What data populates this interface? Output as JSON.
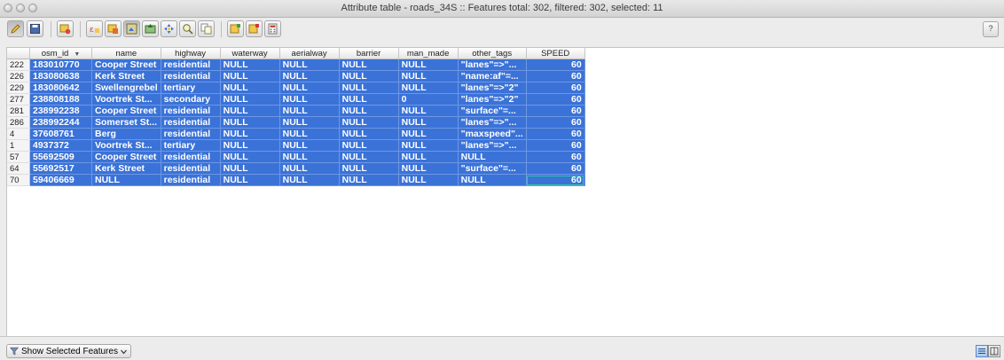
{
  "window": {
    "title": "Attribute table - roads_34S :: Features total: 302, filtered: 302, selected: 11"
  },
  "toolbar": {
    "buttons": [
      "toggle-editing",
      "save-edits",
      "delete-selected",
      "expression-select",
      "select-all",
      "invert-selection",
      "move-selection-to-top",
      "pan-to-selected",
      "zoom-to-selected",
      "copy-selected",
      "add-attribute",
      "delete-attribute",
      "open-field-calculator",
      "conditional-formatting"
    ],
    "help_label": "?"
  },
  "table": {
    "columns": [
      "osm_id",
      "name",
      "highway",
      "waterway",
      "aerialway",
      "barrier",
      "man_made",
      "other_tags",
      "SPEED"
    ],
    "sorted_column": "osm_id",
    "sort_indicator": "▼",
    "rows": [
      {
        "n": "222",
        "cells": [
          "183010770",
          "Cooper Street",
          "residential",
          "NULL",
          "NULL",
          "NULL",
          "NULL",
          "\"lanes\"=>\"...",
          "60"
        ]
      },
      {
        "n": "226",
        "cells": [
          "183080638",
          "Kerk Street",
          "residential",
          "NULL",
          "NULL",
          "NULL",
          "NULL",
          "\"name:af\"=...",
          "60"
        ]
      },
      {
        "n": "229",
        "cells": [
          "183080642",
          "Swellengrebel",
          "tertiary",
          "NULL",
          "NULL",
          "NULL",
          "NULL",
          "\"lanes\"=>\"2\"",
          "60"
        ]
      },
      {
        "n": "277",
        "cells": [
          "238808188",
          "Voortrek St...",
          "secondary",
          "NULL",
          "NULL",
          "NULL",
          "0",
          "\"lanes\"=>\"2\"",
          "60"
        ]
      },
      {
        "n": "281",
        "cells": [
          "238992238",
          "Cooper Street",
          "residential",
          "NULL",
          "NULL",
          "NULL",
          "NULL",
          "\"surface\"=...",
          "60"
        ]
      },
      {
        "n": "286",
        "cells": [
          "238992244",
          "Somerset St...",
          "residential",
          "NULL",
          "NULL",
          "NULL",
          "NULL",
          "\"lanes\"=>\"...",
          "60"
        ]
      },
      {
        "n": "4",
        "cells": [
          "37608761",
          "Berg",
          "residential",
          "NULL",
          "NULL",
          "NULL",
          "NULL",
          "\"maxspeed\"...",
          "60"
        ]
      },
      {
        "n": "1",
        "cells": [
          "4937372",
          "Voortrek St...",
          "tertiary",
          "NULL",
          "NULL",
          "NULL",
          "NULL",
          "\"lanes\"=>\"...",
          "60"
        ]
      },
      {
        "n": "57",
        "cells": [
          "55692509",
          "Cooper Street",
          "residential",
          "NULL",
          "NULL",
          "NULL",
          "NULL",
          "NULL",
          "60"
        ]
      },
      {
        "n": "64",
        "cells": [
          "55692517",
          "Kerk Street",
          "residential",
          "NULL",
          "NULL",
          "NULL",
          "NULL",
          "\"surface\"=...",
          "60"
        ]
      },
      {
        "n": "70",
        "cells": [
          "59406669",
          "NULL",
          "residential",
          "NULL",
          "NULL",
          "NULL",
          "NULL",
          "NULL",
          "60"
        ]
      }
    ]
  },
  "footer": {
    "show_label": "Show Selected Features",
    "dropdown_icon": "chevron-down-icon",
    "view_modes": [
      "table-view",
      "form-view"
    ]
  },
  "colors": {
    "selection": "#3a72d8",
    "current_cell_border": "#2ec4a6"
  }
}
